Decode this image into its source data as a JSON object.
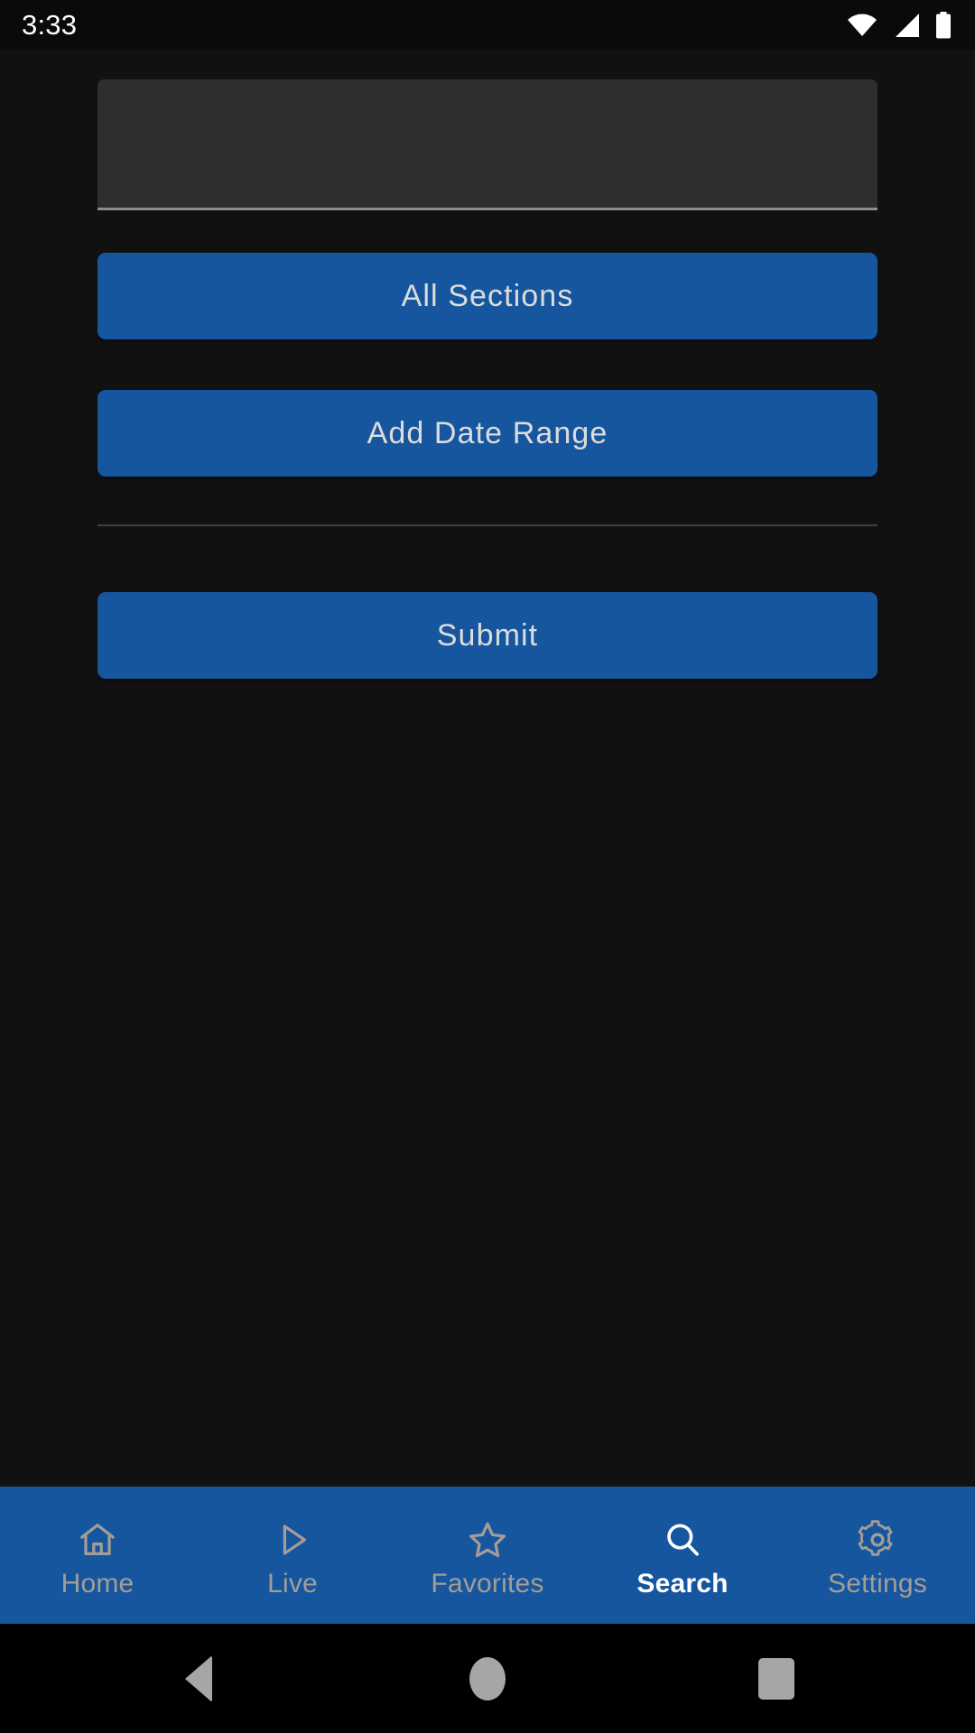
{
  "status_bar": {
    "clock": "3:33",
    "icons": [
      {
        "name": "wifi-icon",
        "label": "Wi-Fi full signal"
      },
      {
        "name": "cellular-signal-icon",
        "label": "Cellular signal"
      },
      {
        "name": "battery-icon",
        "label": "Battery full"
      }
    ]
  },
  "theme": {
    "background": "#111111",
    "accent_blue": "#15569f",
    "field_fill": "#2e2e2e",
    "field_underline": "#8c8c8c",
    "divider": "#3f3f3f",
    "button_text": "#dcdcdc",
    "nav_inactive": "#a39d96",
    "nav_active": "#ffffff"
  },
  "search_form": {
    "query_field": {
      "value": "",
      "placeholder": ""
    },
    "sections_button_label": "All Sections",
    "date_range_button_label": "Add Date Range",
    "submit_button_label": "Submit"
  },
  "bottom_nav": {
    "active_index": 3,
    "items": [
      {
        "label": "Home",
        "icon": "home-icon",
        "active": false
      },
      {
        "label": "Live",
        "icon": "play-icon",
        "active": false
      },
      {
        "label": "Favorites",
        "icon": "star-icon",
        "active": false
      },
      {
        "label": "Search",
        "icon": "search-icon",
        "active": true
      },
      {
        "label": "Settings",
        "icon": "gear-icon",
        "active": false
      }
    ]
  },
  "system_nav": {
    "back": "back-button",
    "home": "home-button",
    "recents": "recents-button"
  }
}
